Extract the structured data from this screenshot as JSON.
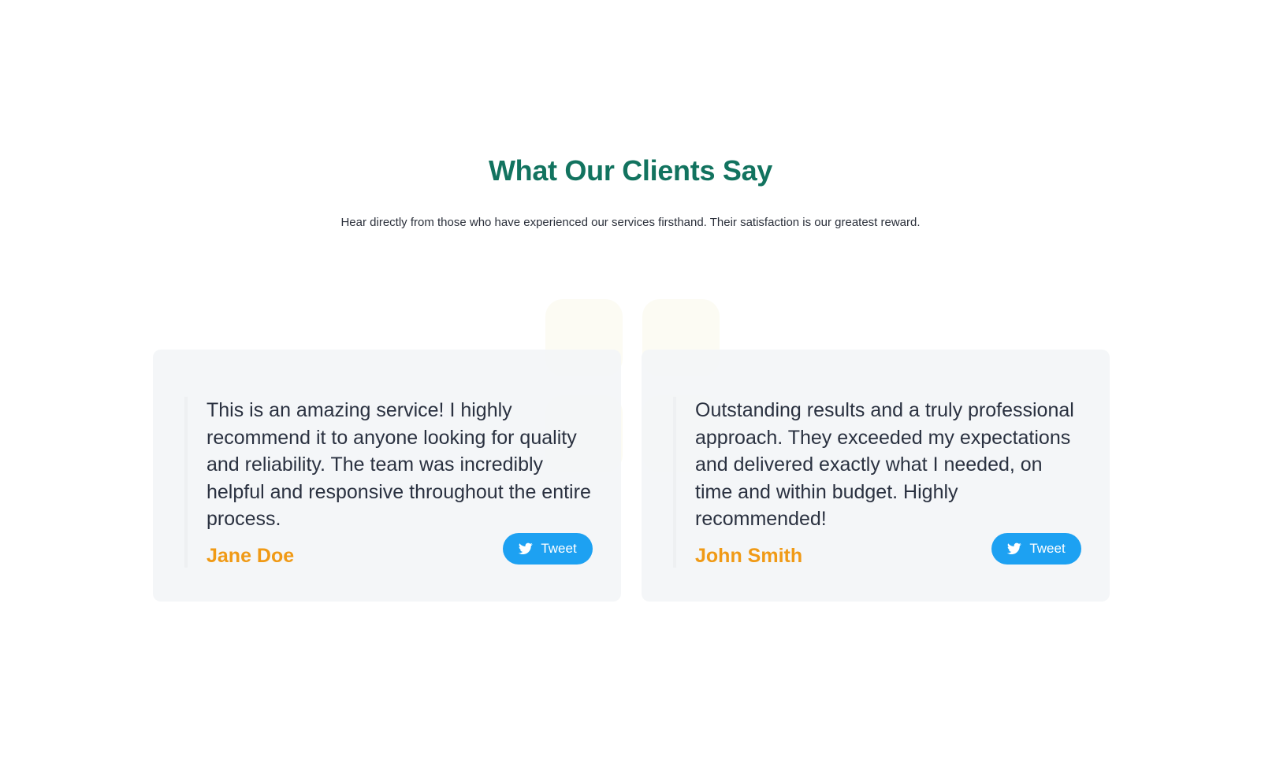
{
  "section": {
    "title": "What Our Clients Say",
    "subtitle": "Hear directly from those who have experienced our services firsthand. Their satisfaction is our greatest reward."
  },
  "testimonials": [
    {
      "quote": "This is an amazing service! I highly recommend it to anyone looking for quality and reliability. The team was incredibly helpful and responsive throughout the entire process.",
      "author": "Jane Doe",
      "button_label": "Tweet",
      "button_icon": "twitter-bird-icon"
    },
    {
      "quote": "Outstanding results and a truly professional approach. They exceeded my expectations and delivered exactly what I needed, on time and within budget. Highly recommended!",
      "author": "John Smith",
      "button_label": "Tweet",
      "button_icon": "twitter-bird-icon"
    }
  ],
  "colors": {
    "title": "#12735f",
    "author": "#f09a16",
    "tweet_button": "#1da1f2",
    "card_background": "#f3f5f7"
  }
}
